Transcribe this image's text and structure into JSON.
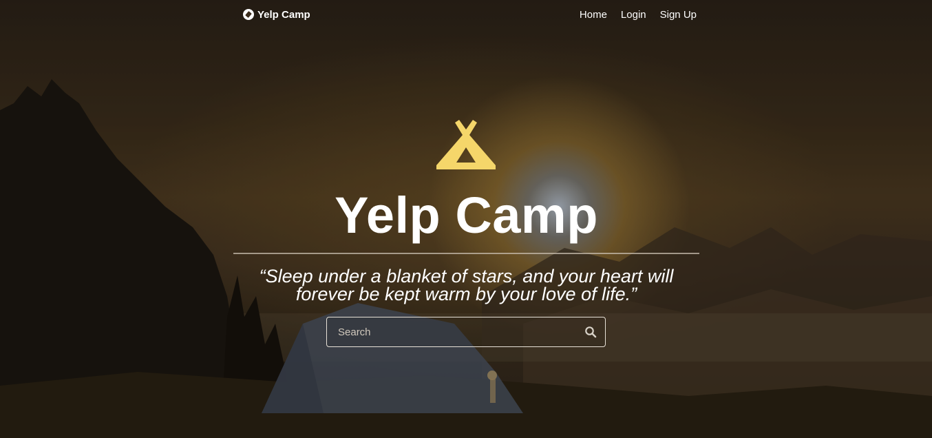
{
  "nav": {
    "brand_icon": "compass-icon",
    "brand": "Yelp Camp",
    "links": [
      {
        "label": "Home"
      },
      {
        "label": "Login"
      },
      {
        "label": "Sign Up"
      }
    ]
  },
  "hero": {
    "icon": "tent-icon",
    "icon_color": "#f5d66a",
    "title": "Yelp Camp",
    "quote": "“Sleep under a blanket of stars, and your heart will forever be kept warm by your love of life.”"
  },
  "search": {
    "placeholder": "Search",
    "icon": "search-icon"
  }
}
